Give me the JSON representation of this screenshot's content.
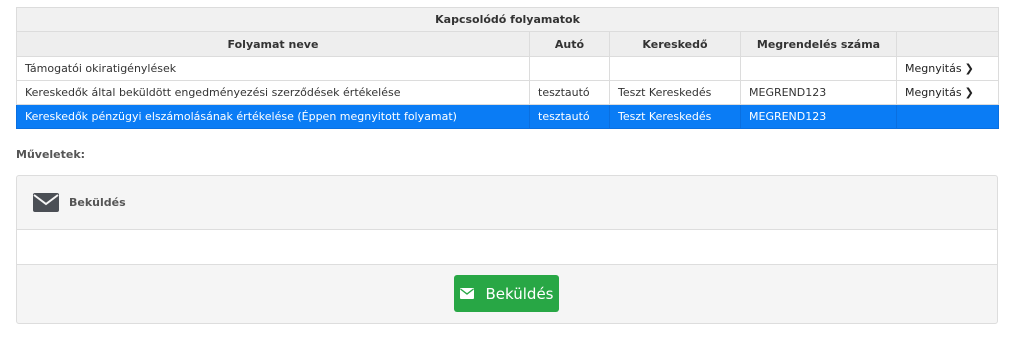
{
  "table": {
    "caption": "Kapcsolódó folyamatok",
    "headers": {
      "name": "Folyamat neve",
      "car": "Autó",
      "dealer": "Kereskedő",
      "order": "Megrendelés száma"
    },
    "rows": [
      {
        "name": "Támogatói okiratigénylések",
        "car": "",
        "dealer": "",
        "order": "",
        "action": "Megnyitás"
      },
      {
        "name": "Kereskedők által beküldött engedményezési szerződések értékelése",
        "car": "tesztautó",
        "dealer": "Teszt Kereskedés",
        "order": "MEGREND123",
        "action": "Megnyitás"
      },
      {
        "name": "Kereskedők pénzügyi elszámolásának értékelése (Éppen megnyitott folyamat)",
        "car": "tesztautó",
        "dealer": "Teszt Kereskedés",
        "order": "MEGREND123",
        "action": ""
      }
    ]
  },
  "operations": {
    "label": "Műveletek:",
    "panel_title": "Beküldés",
    "button_label": "Beküldés"
  },
  "colors": {
    "selected_row": "#0a7cf5",
    "button": "#28a745"
  },
  "icons": {
    "open": "chevron-right-icon",
    "envelope": "envelope-icon"
  }
}
